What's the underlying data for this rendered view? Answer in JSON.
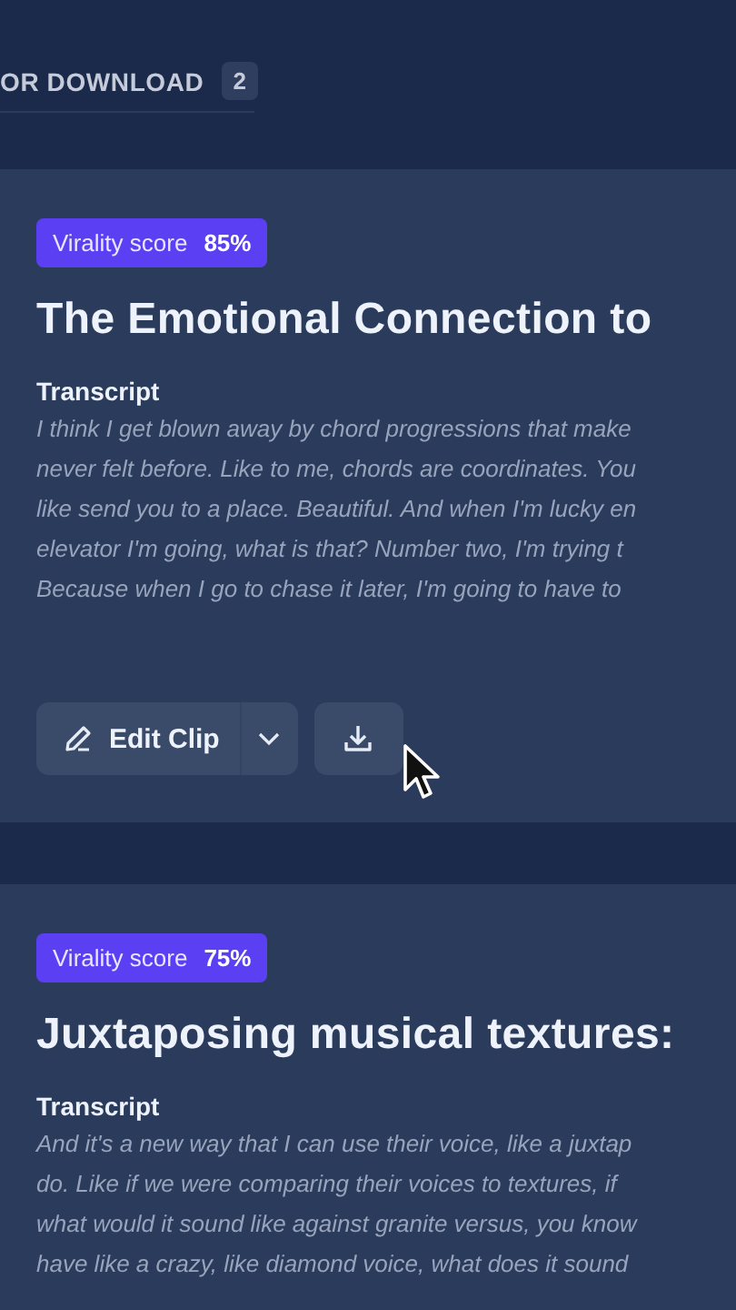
{
  "tab": {
    "label": "OR DOWNLOAD",
    "count": "2"
  },
  "clips": [
    {
      "badge": {
        "label": "Virality score",
        "value": "85%"
      },
      "title": "The Emotional Connection to",
      "transcript_label": "Transcript",
      "transcript_lines": [
        "I think I get blown away by chord progressions that make",
        "never felt before. Like to me, chords are coordinates. You",
        "like send you to a place. Beautiful. And when I'm lucky en",
        "elevator I'm going, what is that? Number two, I'm trying t",
        "Because when I go to chase it later, I'm going to have to"
      ],
      "actions": {
        "edit_label": "Edit Clip"
      }
    },
    {
      "badge": {
        "label": "Virality score",
        "value": "75%"
      },
      "title": "Juxtaposing musical textures:",
      "transcript_label": "Transcript",
      "transcript_lines": [
        "And it's a new way that I can use their voice, like a juxtap",
        "do. Like if we were comparing their voices to textures, if",
        "what would it sound like against granite versus, you know",
        "have like a crazy, like diamond voice, what does it sound"
      ]
    }
  ]
}
